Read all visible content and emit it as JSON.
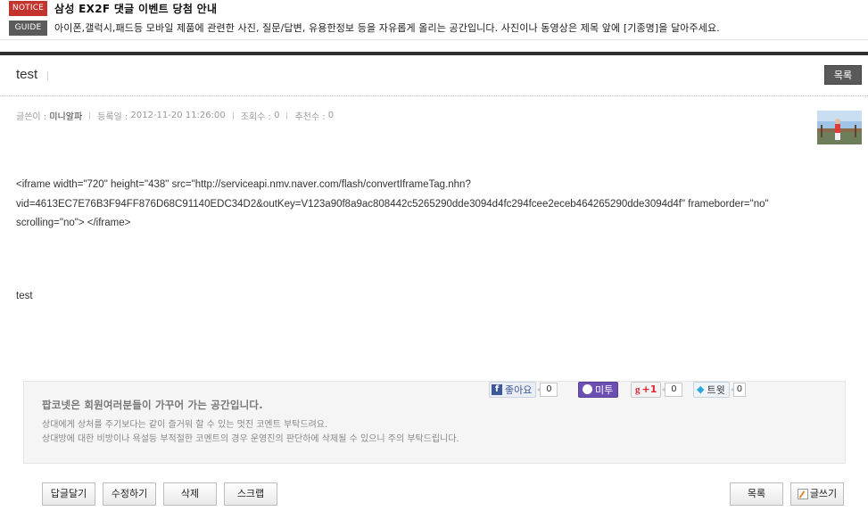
{
  "notice": {
    "tag": "NOTICE",
    "title": "삼성 EX2F 댓글 이벤트 당첨 안내"
  },
  "guide": {
    "tag": "GUIDE",
    "text": "아이폰,갤럭시,패드등 모바일 제품에 관련한 사진, 질문/답변, 유용한정보 등을 자유롭게 올리는 공간입니다. 사진이나 동영상은 제목 앞에 [기종명]을 달아주세요."
  },
  "post": {
    "title": "test",
    "list_button": "목록",
    "meta": {
      "author_label": "글쓴이 :",
      "author": "미니알파",
      "date_label": "등록일 :",
      "date": "2012-11-20 11:26:00",
      "views_label": "조회수 :",
      "views": "0",
      "recommend_label": "추천수 :",
      "recommend": "0"
    },
    "body_lines": [
      "<iframe width=\"720\" height=\"438\" src=\"http://serviceapi.nmv.naver.com/flash/convertIframeTag.nhn?",
      "vid=4613EC7E76B3F94FF876D68C91140EDC34D2&outKey=V123a90f8a9ac808442c5265290dde3094d4fc294fcee2eceb464265290dde3094d4f\" frameborder=\"no\"",
      "scrolling=\"no\"> </iframe>"
    ],
    "body_text": "test"
  },
  "social": {
    "facebook_label": "좋아요",
    "facebook_count": "0",
    "me2day_label": "미투",
    "gplus_label": "+1",
    "gplus_count": "0",
    "twitter_label": "트윗",
    "twitter_count": "0"
  },
  "comment_guide": {
    "heading": "팝코넷은 회원여러분들이 가꾸어 가는 공간입니다.",
    "line1": "상대에게 상처를 주기보다는 같이 즐거워 할 수 있는 멋진 코멘트 부탁드려요.",
    "line2": "상대방에 대한 비방이나 욕설등 부적절한 코멘트의 경우 운영진의 판단하에 삭제될 수 있으니 주의 부탁드립니다."
  },
  "actions": {
    "reply": "답글달기",
    "edit": "수정하기",
    "delete": "삭제",
    "scrap": "스크랩",
    "list": "목록",
    "write": "글쓰기"
  },
  "colors": {
    "notice_tag": "#c4342f",
    "guide_tag": "#5b5b5b",
    "header_bar": "#2f2f2f",
    "me2day": "#6c4fb3",
    "facebook": "#3b5998"
  }
}
